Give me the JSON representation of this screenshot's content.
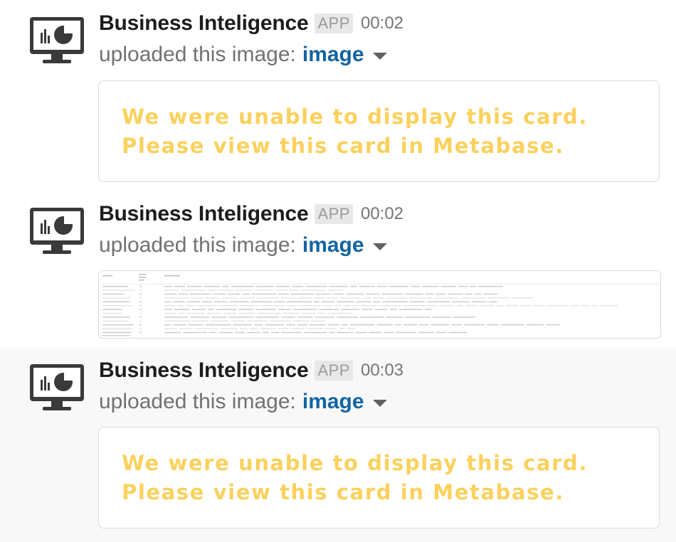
{
  "colors": {
    "link": "#1264a3",
    "card_text": "#fbd15d",
    "hover_bg": "#f8f8f8"
  },
  "messages": [
    {
      "sender": "Business Inteligence",
      "badge": "APP",
      "time": "00:02",
      "action": "uploaded this image:",
      "link": "image",
      "avatar_icon": "monitor-chart-icon",
      "card": {
        "line1": "We were unable to display this card.",
        "line2": "Please view this card in Metabase."
      }
    },
    {
      "sender": "Business Inteligence",
      "badge": "APP",
      "time": "00:02",
      "action": "uploaded this image:",
      "link": "image",
      "avatar_icon": "monitor-chart-icon",
      "thumbnail": "table-image-thumbnail"
    },
    {
      "sender": "Business Inteligence",
      "badge": "APP",
      "time": "00:03",
      "action": "uploaded this image:",
      "link": "image",
      "avatar_icon": "monitor-chart-icon",
      "card": {
        "line1": "We were unable to display this card.",
        "line2": "Please view this card in Metabase."
      }
    }
  ]
}
